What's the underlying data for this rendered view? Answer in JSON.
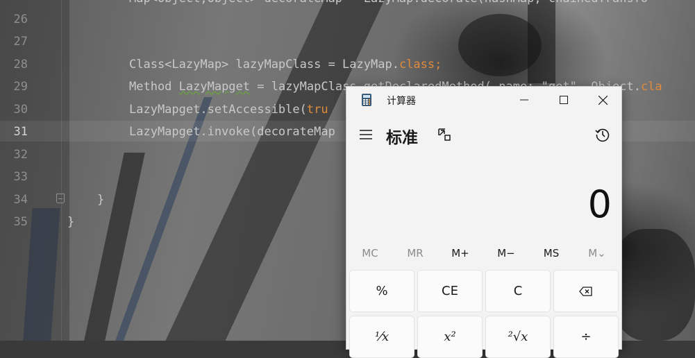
{
  "editor": {
    "line_numbers": [
      "26",
      "27",
      "28",
      "29",
      "30",
      "31",
      "32",
      "33",
      "34",
      "35"
    ],
    "active_line": "31",
    "code_top_partial": "Map<Object,Object> decorateMap = LazyMap.decorate(hashMap, chainedTransfo",
    "l28_a": "Class<LazyMap> lazyMapClass = LazyMap.",
    "l28_kw": "class",
    "l28_b": ";",
    "l29_a": "Method ",
    "l29_var": "LazyMapget",
    "l29_b": " = lazyMapClass.getDeclaredMethod( name: \"get\", Object.",
    "l29_kw": "cla",
    "l30_a": "LazyMapget.setAccessible(",
    "l30_kw": "tru",
    "l31": "LazyMapget.invoke(decorateMap",
    "l34": "}",
    "l35": "}"
  },
  "calculator": {
    "app_title": "计算器",
    "mode_title": "标准",
    "display_value": "0",
    "memory": [
      "MC",
      "MR",
      "M+",
      "M−",
      "MS",
      "M⌄"
    ],
    "keys_row1": [
      "%",
      "CE",
      "C",
      "⌫"
    ],
    "keys_row2": [
      "⅟x",
      "x²",
      "²√x",
      "÷"
    ],
    "icons": {
      "app": "calculator-icon",
      "minimize": "minimize-icon",
      "maximize": "maximize-icon",
      "close": "close-icon",
      "menu": "hamburger-menu-icon",
      "keep_on_top": "keep-on-top-icon",
      "history": "history-icon"
    }
  }
}
